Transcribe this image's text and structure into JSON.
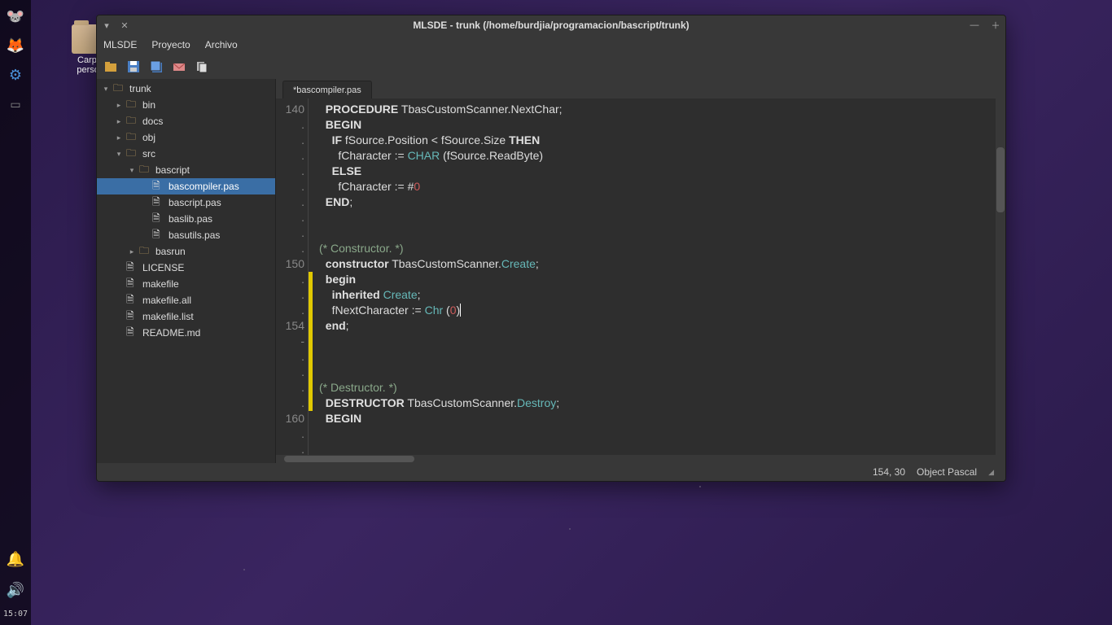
{
  "desktop": {
    "folder_label": "Carpe\npersor"
  },
  "dock": {
    "time": "15:07"
  },
  "window": {
    "title": "MLSDE - trunk (/home/burdjia/programacion/bascript/trunk)",
    "menu": {
      "mlsde": "MLSDE",
      "proyecto": "Proyecto",
      "archivo": "Archivo"
    },
    "tree": {
      "root": "trunk",
      "items": [
        {
          "label": "bin",
          "type": "folder",
          "indent": 1
        },
        {
          "label": "docs",
          "type": "folder",
          "indent": 1
        },
        {
          "label": "obj",
          "type": "folder",
          "indent": 1
        },
        {
          "label": "src",
          "type": "folder",
          "indent": 1,
          "expanded": true
        },
        {
          "label": "bascript",
          "type": "folder",
          "indent": 2,
          "expanded": true
        },
        {
          "label": "bascompiler.pas",
          "type": "file",
          "indent": 3,
          "selected": true
        },
        {
          "label": "bascript.pas",
          "type": "file",
          "indent": 3
        },
        {
          "label": "baslib.pas",
          "type": "file",
          "indent": 3
        },
        {
          "label": "basutils.pas",
          "type": "file",
          "indent": 3
        },
        {
          "label": "basrun",
          "type": "folder",
          "indent": 2
        },
        {
          "label": "LICENSE",
          "type": "file",
          "indent": 1
        },
        {
          "label": "makefile",
          "type": "file",
          "indent": 1
        },
        {
          "label": "makefile.all",
          "type": "file",
          "indent": 1
        },
        {
          "label": "makefile.list",
          "type": "file",
          "indent": 1
        },
        {
          "label": "README.md",
          "type": "file",
          "indent": 1
        }
      ]
    },
    "tab": "*bascompiler.pas",
    "gutter": [
      "140",
      ".",
      ".",
      ".",
      ".",
      ".",
      ".",
      ".",
      ".",
      ".",
      "150",
      ".",
      ".",
      ".",
      "154",
      "-",
      ".",
      ".",
      ".",
      ".",
      "160",
      ".",
      "."
    ],
    "change_marks": [
      0,
      0,
      0,
      0,
      0,
      0,
      0,
      0,
      0,
      0,
      0,
      1,
      1,
      1,
      1,
      1,
      1,
      1,
      1,
      1,
      0,
      0,
      0
    ],
    "status": {
      "pos": "154, 30",
      "lang": "Object Pascal"
    }
  }
}
